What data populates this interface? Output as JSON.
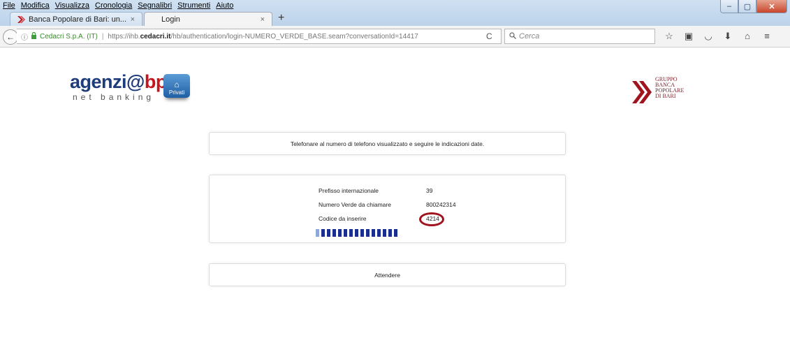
{
  "menu": [
    "File",
    "Modifica",
    "Visualizza",
    "Cronologia",
    "Segnalibri",
    "Strumenti",
    "Aiuto"
  ],
  "window_controls": {
    "minimize": "–",
    "maximize": "▢",
    "close": "✕"
  },
  "tabs": [
    {
      "label": "Banca Popolare di Bari: un...",
      "close": "×"
    },
    {
      "label": "Login",
      "close": "×"
    }
  ],
  "new_tab": "+",
  "navbar": {
    "back": "←",
    "info_icon": "ⓘ",
    "lock_icon": "🔒",
    "org": "Cedacri S.p.A. (IT)",
    "separator": "|",
    "url_prefix": "https://ihb.",
    "url_domain": "cedacri.it",
    "url_path": "/hb/authentication/login-NUMERO_VERDE_BASE.seam?conversationId=14417",
    "reload": "C",
    "search_placeholder": "Cerca",
    "icons": [
      "star-icon",
      "clipboard-icon",
      "pocket-icon",
      "download-icon",
      "home-icon",
      "menu-icon"
    ]
  },
  "logo": {
    "name": "agenzi",
    "at": "@",
    "brand": "bpb",
    "sub": "net banking",
    "privati": "Privati"
  },
  "gruppo": {
    "lines": [
      "GRUPPO",
      "BANCA",
      "POPOLARE",
      "DI BARI"
    ]
  },
  "message": "Telefonare al numero di telefono visualizzato e seguire le indicazioni date.",
  "info": [
    {
      "label": "Prefisso internazionale",
      "value": "39"
    },
    {
      "label": "Numero Verde da chiamare",
      "value": "800242314"
    },
    {
      "label": "Codice da inserire",
      "value": "4214"
    }
  ],
  "progress": {
    "segments_total": 15,
    "segments_done": 1
  },
  "wait_button": "Attendere",
  "colors": {
    "brand_blue": "#1e3b7a",
    "brand_red": "#c4161c",
    "highlight": "#a0141e",
    "progress": "#1b2e8f"
  }
}
